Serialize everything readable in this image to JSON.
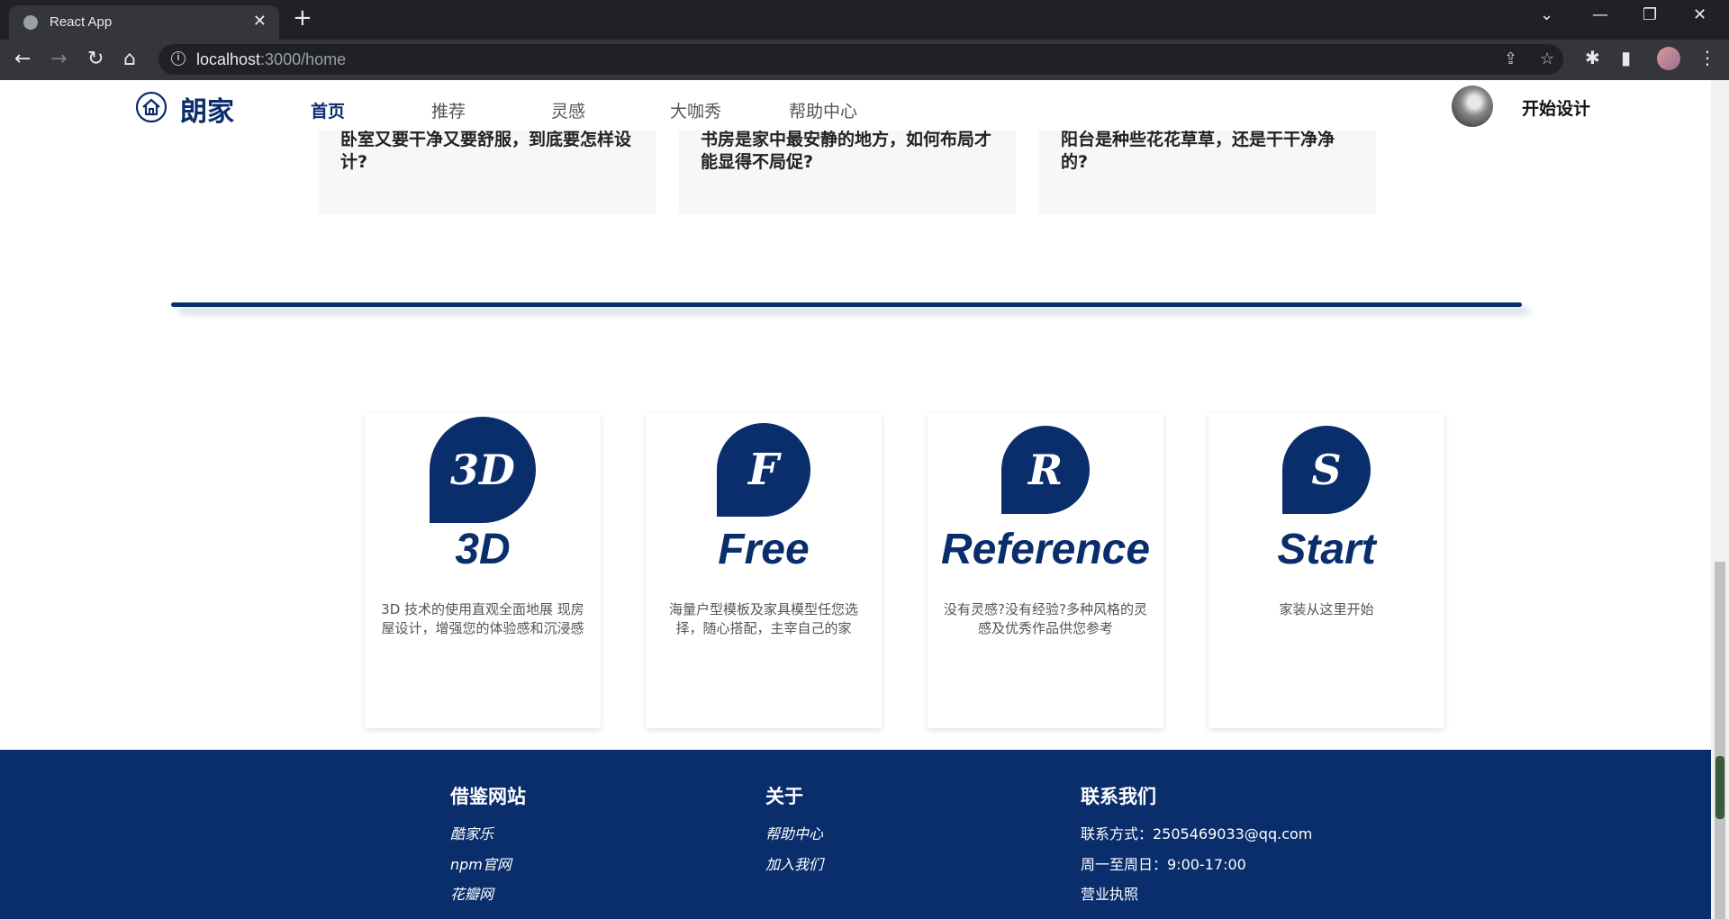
{
  "browser": {
    "tab_title": "React App",
    "tab_close": "✕",
    "new_tab": "+",
    "url_host": "localhost",
    "url_path": ":3000/home",
    "win_minimize": "—",
    "win_restore": "❐",
    "win_close": "✕",
    "tab_search": "⌄"
  },
  "header": {
    "logo_text": "朗家",
    "nav": [
      "首页",
      "推荐",
      "灵感",
      "大咖秀",
      "帮助中心"
    ],
    "start_design": "开始设计"
  },
  "articles": [
    {
      "title": "卧室又要干净又要舒服，到底要怎样设计?"
    },
    {
      "title": "书房是家中最安静的地方，如何布局才能显得不局促?"
    },
    {
      "title": "阳台是种些花花草草，还是干干净净的?"
    }
  ],
  "features": [
    {
      "badge": "3D",
      "title": "3D",
      "desc": "3D 技术的使用直观全面地展 现房屋设计，增强您的体验感和沉浸感"
    },
    {
      "badge": "F",
      "title": "Free",
      "desc": "海量户型模板及家具模型任您选择，随心搭配，主宰自己的家"
    },
    {
      "badge": "R",
      "title": "Reference",
      "desc": "没有灵感?没有经验?多种风格的灵感及优秀作品供您参考"
    },
    {
      "badge": "S",
      "title": "Start",
      "desc": "家装从这里开始"
    }
  ],
  "footer": {
    "col1": {
      "heading": "借鉴网站",
      "links": [
        "酷家乐",
        "npm官网",
        "花瓣网"
      ]
    },
    "col2": {
      "heading": "关于",
      "links": [
        "帮助中心",
        "加入我们"
      ]
    },
    "col3": {
      "heading": "联系我们",
      "lines": [
        "联系方式：2505469033@qq.com",
        "周一至周日：9:00-17:00",
        "营业执照"
      ]
    }
  },
  "colors": {
    "brand": "#0a2d6b"
  }
}
